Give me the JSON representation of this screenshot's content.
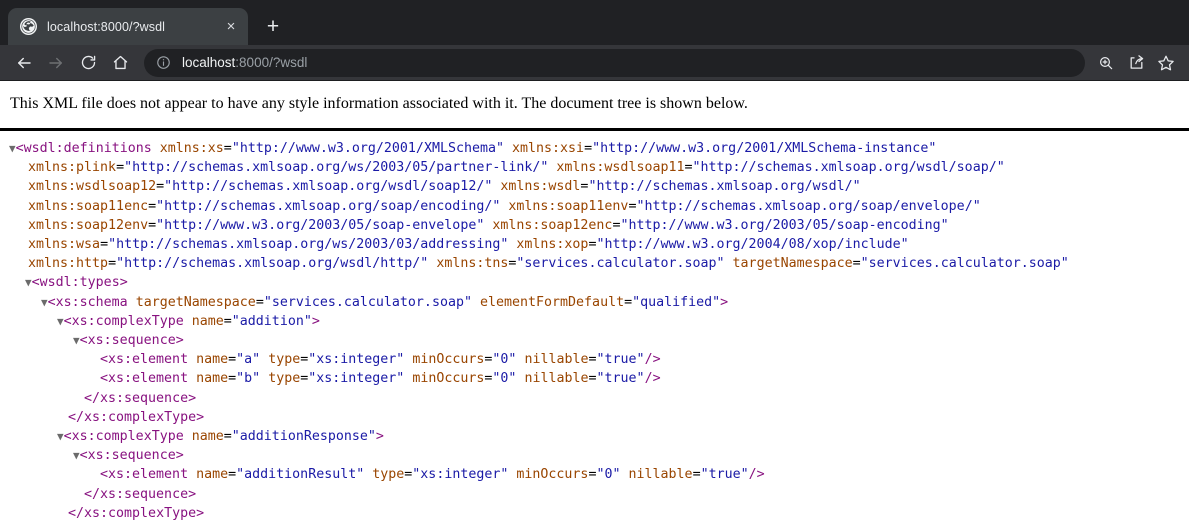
{
  "browser": {
    "tab": {
      "title": "localhost:8000/?wsdl",
      "favicon_name": "globe-icon",
      "close_label": "×"
    },
    "new_tab_label": "+",
    "nav": {
      "back_label": "Back",
      "forward_label": "Forward",
      "reload_label": "Reload",
      "home_label": "Home"
    },
    "omnibox": {
      "host": "localhost",
      "path": ":8000/?wsdl",
      "full_url": "localhost:8000/?wsdl",
      "site_info_label": "View site information"
    },
    "toolbar_icons": {
      "zoom_label": "Zoom",
      "share_label": "Share this page",
      "bookmark_label": "Bookmark this tab"
    },
    "colors": {
      "tabstrip_bg": "#202124",
      "tab_bg": "#3c4043",
      "toolbar_bg": "#35363a",
      "omnibox_bg": "#202124",
      "text_light": "#e8eaed",
      "text_dim": "#9aa0a6"
    }
  },
  "page": {
    "notice": "This XML file does not appear to have any style information associated with it. The document tree is shown below.",
    "syntax_colors": {
      "tag": "#881280",
      "attribute_name": "#994500",
      "attribute_value": "#1a1aa6",
      "text": "#000000",
      "twisty": "#7f7f7f"
    }
  },
  "xml": {
    "root_tag": "wsdl:definitions",
    "namespaces": [
      {
        "prefix": "xmlns:xs",
        "value": "http://www.w3.org/2001/XMLSchema"
      },
      {
        "prefix": "xmlns:xsi",
        "value": "http://www.w3.org/2001/XMLSchema-instance"
      },
      {
        "prefix": "xmlns:plink",
        "value": "http://schemas.xmlsoap.org/ws/2003/05/partner-link/"
      },
      {
        "prefix": "xmlns:wsdlsoap11",
        "value": "http://schemas.xmlsoap.org/wsdl/soap/"
      },
      {
        "prefix": "xmlns:wsdlsoap12",
        "value": "http://schemas.xmlsoap.org/wsdl/soap12/"
      },
      {
        "prefix": "xmlns:wsdl",
        "value": "http://schemas.xmlsoap.org/wsdl/"
      },
      {
        "prefix": "xmlns:soap11enc",
        "value": "http://schemas.xmlsoap.org/soap/encoding/"
      },
      {
        "prefix": "xmlns:soap11env",
        "value": "http://schemas.xmlsoap.org/soap/envelope/"
      },
      {
        "prefix": "xmlns:soap12env",
        "value": "http://www.w3.org/2003/05/soap-envelope"
      },
      {
        "prefix": "xmlns:soap12enc",
        "value": "http://www.w3.org/2003/05/soap-encoding"
      },
      {
        "prefix": "xmlns:wsa",
        "value": "http://schemas.xmlsoap.org/ws/2003/03/addressing"
      },
      {
        "prefix": "xmlns:xop",
        "value": "http://www.w3.org/2004/08/xop/include"
      },
      {
        "prefix": "xmlns:http",
        "value": "http://schemas.xmlsoap.org/wsdl/http/"
      },
      {
        "prefix": "xmlns:tns",
        "value": "services.calculator.soap"
      },
      {
        "prefix": "targetNamespace",
        "value": "services.calculator.soap"
      }
    ],
    "lines": [
      {
        "indent": 0,
        "twisty": true,
        "segments": [
          {
            "t": "punc",
            "v": "<"
          },
          {
            "t": "tag",
            "v": "wsdl:definitions"
          },
          {
            "t": "plain",
            "v": " "
          },
          {
            "t": "attrname",
            "v": "xmlns:xs"
          },
          {
            "t": "eq",
            "v": "="
          },
          {
            "t": "attrval",
            "v": "\"http://www.w3.org/2001/XMLSchema\""
          },
          {
            "t": "plain",
            "v": " "
          },
          {
            "t": "attrname",
            "v": "xmlns:xsi"
          },
          {
            "t": "eq",
            "v": "="
          },
          {
            "t": "attrval",
            "v": "\"http://www.w3.org/2001/XMLSchema-instance\""
          }
        ]
      },
      {
        "indent": 0,
        "twisty": false,
        "cont": true,
        "segments": [
          {
            "t": "attrname",
            "v": "xmlns:plink"
          },
          {
            "t": "eq",
            "v": "="
          },
          {
            "t": "attrval",
            "v": "\"http://schemas.xmlsoap.org/ws/2003/05/partner-link/\""
          },
          {
            "t": "plain",
            "v": " "
          },
          {
            "t": "attrname",
            "v": "xmlns:wsdlsoap11"
          },
          {
            "t": "eq",
            "v": "="
          },
          {
            "t": "attrval",
            "v": "\"http://schemas.xmlsoap.org/wsdl/soap/\""
          }
        ]
      },
      {
        "indent": 0,
        "twisty": false,
        "cont": true,
        "segments": [
          {
            "t": "attrname",
            "v": "xmlns:wsdlsoap12"
          },
          {
            "t": "eq",
            "v": "="
          },
          {
            "t": "attrval",
            "v": "\"http://schemas.xmlsoap.org/wsdl/soap12/\""
          },
          {
            "t": "plain",
            "v": " "
          },
          {
            "t": "attrname",
            "v": "xmlns:wsdl"
          },
          {
            "t": "eq",
            "v": "="
          },
          {
            "t": "attrval",
            "v": "\"http://schemas.xmlsoap.org/wsdl/\""
          }
        ]
      },
      {
        "indent": 0,
        "twisty": false,
        "cont": true,
        "segments": [
          {
            "t": "attrname",
            "v": "xmlns:soap11enc"
          },
          {
            "t": "eq",
            "v": "="
          },
          {
            "t": "attrval",
            "v": "\"http://schemas.xmlsoap.org/soap/encoding/\""
          },
          {
            "t": "plain",
            "v": " "
          },
          {
            "t": "attrname",
            "v": "xmlns:soap11env"
          },
          {
            "t": "eq",
            "v": "="
          },
          {
            "t": "attrval",
            "v": "\"http://schemas.xmlsoap.org/soap/envelope/\""
          }
        ]
      },
      {
        "indent": 0,
        "twisty": false,
        "cont": true,
        "segments": [
          {
            "t": "attrname",
            "v": "xmlns:soap12env"
          },
          {
            "t": "eq",
            "v": "="
          },
          {
            "t": "attrval",
            "v": "\"http://www.w3.org/2003/05/soap-envelope\""
          },
          {
            "t": "plain",
            "v": " "
          },
          {
            "t": "attrname",
            "v": "xmlns:soap12enc"
          },
          {
            "t": "eq",
            "v": "="
          },
          {
            "t": "attrval",
            "v": "\"http://www.w3.org/2003/05/soap-encoding\""
          }
        ]
      },
      {
        "indent": 0,
        "twisty": false,
        "cont": true,
        "segments": [
          {
            "t": "attrname",
            "v": "xmlns:wsa"
          },
          {
            "t": "eq",
            "v": "="
          },
          {
            "t": "attrval",
            "v": "\"http://schemas.xmlsoap.org/ws/2003/03/addressing\""
          },
          {
            "t": "plain",
            "v": " "
          },
          {
            "t": "attrname",
            "v": "xmlns:xop"
          },
          {
            "t": "eq",
            "v": "="
          },
          {
            "t": "attrval",
            "v": "\"http://www.w3.org/2004/08/xop/include\""
          }
        ]
      },
      {
        "indent": 0,
        "twisty": false,
        "cont": true,
        "segments": [
          {
            "t": "attrname",
            "v": "xmlns:http"
          },
          {
            "t": "eq",
            "v": "="
          },
          {
            "t": "attrval",
            "v": "\"http://schemas.xmlsoap.org/wsdl/http/\""
          },
          {
            "t": "plain",
            "v": " "
          },
          {
            "t": "attrname",
            "v": "xmlns:tns"
          },
          {
            "t": "eq",
            "v": "="
          },
          {
            "t": "attrval",
            "v": "\"services.calculator.soap\""
          },
          {
            "t": "plain",
            "v": " "
          },
          {
            "t": "attrname",
            "v": "targetNamespace"
          },
          {
            "t": "eq",
            "v": "="
          },
          {
            "t": "attrval",
            "v": "\"services.calculator.soap\""
          }
        ]
      },
      {
        "indent": 1,
        "twisty": true,
        "segments": [
          {
            "t": "punc",
            "v": "<"
          },
          {
            "t": "tag",
            "v": "wsdl:types"
          },
          {
            "t": "punc",
            "v": ">"
          }
        ]
      },
      {
        "indent": 2,
        "twisty": true,
        "segments": [
          {
            "t": "punc",
            "v": "<"
          },
          {
            "t": "tag",
            "v": "xs:schema"
          },
          {
            "t": "plain",
            "v": " "
          },
          {
            "t": "attrname",
            "v": "targetNamespace"
          },
          {
            "t": "eq",
            "v": "="
          },
          {
            "t": "attrval",
            "v": "\"services.calculator.soap\""
          },
          {
            "t": "plain",
            "v": " "
          },
          {
            "t": "attrname",
            "v": "elementFormDefault"
          },
          {
            "t": "eq",
            "v": "="
          },
          {
            "t": "attrval",
            "v": "\"qualified\""
          },
          {
            "t": "punc",
            "v": ">"
          }
        ]
      },
      {
        "indent": 3,
        "twisty": true,
        "segments": [
          {
            "t": "punc",
            "v": "<"
          },
          {
            "t": "tag",
            "v": "xs:complexType"
          },
          {
            "t": "plain",
            "v": " "
          },
          {
            "t": "attrname",
            "v": "name"
          },
          {
            "t": "eq",
            "v": "="
          },
          {
            "t": "attrval",
            "v": "\"addition\""
          },
          {
            "t": "punc",
            "v": ">"
          }
        ]
      },
      {
        "indent": 4,
        "twisty": true,
        "segments": [
          {
            "t": "punc",
            "v": "<"
          },
          {
            "t": "tag",
            "v": "xs:sequence"
          },
          {
            "t": "punc",
            "v": ">"
          }
        ]
      },
      {
        "indent": 5,
        "twisty": false,
        "segments": [
          {
            "t": "punc",
            "v": "<"
          },
          {
            "t": "tag",
            "v": "xs:element"
          },
          {
            "t": "plain",
            "v": " "
          },
          {
            "t": "attrname",
            "v": "name"
          },
          {
            "t": "eq",
            "v": "="
          },
          {
            "t": "attrval",
            "v": "\"a\""
          },
          {
            "t": "plain",
            "v": " "
          },
          {
            "t": "attrname",
            "v": "type"
          },
          {
            "t": "eq",
            "v": "="
          },
          {
            "t": "attrval",
            "v": "\"xs:integer\""
          },
          {
            "t": "plain",
            "v": " "
          },
          {
            "t": "attrname",
            "v": "minOccurs"
          },
          {
            "t": "eq",
            "v": "="
          },
          {
            "t": "attrval",
            "v": "\"0\""
          },
          {
            "t": "plain",
            "v": " "
          },
          {
            "t": "attrname",
            "v": "nillable"
          },
          {
            "t": "eq",
            "v": "="
          },
          {
            "t": "attrval",
            "v": "\"true\""
          },
          {
            "t": "punc",
            "v": "/>"
          }
        ]
      },
      {
        "indent": 5,
        "twisty": false,
        "segments": [
          {
            "t": "punc",
            "v": "<"
          },
          {
            "t": "tag",
            "v": "xs:element"
          },
          {
            "t": "plain",
            "v": " "
          },
          {
            "t": "attrname",
            "v": "name"
          },
          {
            "t": "eq",
            "v": "="
          },
          {
            "t": "attrval",
            "v": "\"b\""
          },
          {
            "t": "plain",
            "v": " "
          },
          {
            "t": "attrname",
            "v": "type"
          },
          {
            "t": "eq",
            "v": "="
          },
          {
            "t": "attrval",
            "v": "\"xs:integer\""
          },
          {
            "t": "plain",
            "v": " "
          },
          {
            "t": "attrname",
            "v": "minOccurs"
          },
          {
            "t": "eq",
            "v": "="
          },
          {
            "t": "attrval",
            "v": "\"0\""
          },
          {
            "t": "plain",
            "v": " "
          },
          {
            "t": "attrname",
            "v": "nillable"
          },
          {
            "t": "eq",
            "v": "="
          },
          {
            "t": "attrval",
            "v": "\"true\""
          },
          {
            "t": "punc",
            "v": "/>"
          }
        ]
      },
      {
        "indent": 4,
        "twisty": false,
        "segments": [
          {
            "t": "punc",
            "v": "</"
          },
          {
            "t": "tag",
            "v": "xs:sequence"
          },
          {
            "t": "punc",
            "v": ">"
          }
        ]
      },
      {
        "indent": 3,
        "twisty": false,
        "segments": [
          {
            "t": "punc",
            "v": "</"
          },
          {
            "t": "tag",
            "v": "xs:complexType"
          },
          {
            "t": "punc",
            "v": ">"
          }
        ]
      },
      {
        "indent": 3,
        "twisty": true,
        "segments": [
          {
            "t": "punc",
            "v": "<"
          },
          {
            "t": "tag",
            "v": "xs:complexType"
          },
          {
            "t": "plain",
            "v": " "
          },
          {
            "t": "attrname",
            "v": "name"
          },
          {
            "t": "eq",
            "v": "="
          },
          {
            "t": "attrval",
            "v": "\"additionResponse\""
          },
          {
            "t": "punc",
            "v": ">"
          }
        ]
      },
      {
        "indent": 4,
        "twisty": true,
        "segments": [
          {
            "t": "punc",
            "v": "<"
          },
          {
            "t": "tag",
            "v": "xs:sequence"
          },
          {
            "t": "punc",
            "v": ">"
          }
        ]
      },
      {
        "indent": 5,
        "twisty": false,
        "segments": [
          {
            "t": "punc",
            "v": "<"
          },
          {
            "t": "tag",
            "v": "xs:element"
          },
          {
            "t": "plain",
            "v": " "
          },
          {
            "t": "attrname",
            "v": "name"
          },
          {
            "t": "eq",
            "v": "="
          },
          {
            "t": "attrval",
            "v": "\"additionResult\""
          },
          {
            "t": "plain",
            "v": " "
          },
          {
            "t": "attrname",
            "v": "type"
          },
          {
            "t": "eq",
            "v": "="
          },
          {
            "t": "attrval",
            "v": "\"xs:integer\""
          },
          {
            "t": "plain",
            "v": " "
          },
          {
            "t": "attrname",
            "v": "minOccurs"
          },
          {
            "t": "eq",
            "v": "="
          },
          {
            "t": "attrval",
            "v": "\"0\""
          },
          {
            "t": "plain",
            "v": " "
          },
          {
            "t": "attrname",
            "v": "nillable"
          },
          {
            "t": "eq",
            "v": "="
          },
          {
            "t": "attrval",
            "v": "\"true\""
          },
          {
            "t": "punc",
            "v": "/>"
          }
        ]
      },
      {
        "indent": 4,
        "twisty": false,
        "segments": [
          {
            "t": "punc",
            "v": "</"
          },
          {
            "t": "tag",
            "v": "xs:sequence"
          },
          {
            "t": "punc",
            "v": ">"
          }
        ]
      },
      {
        "indent": 3,
        "twisty": false,
        "segments": [
          {
            "t": "punc",
            "v": "</"
          },
          {
            "t": "tag",
            "v": "xs:complexType"
          },
          {
            "t": "punc",
            "v": ">"
          }
        ]
      }
    ]
  }
}
